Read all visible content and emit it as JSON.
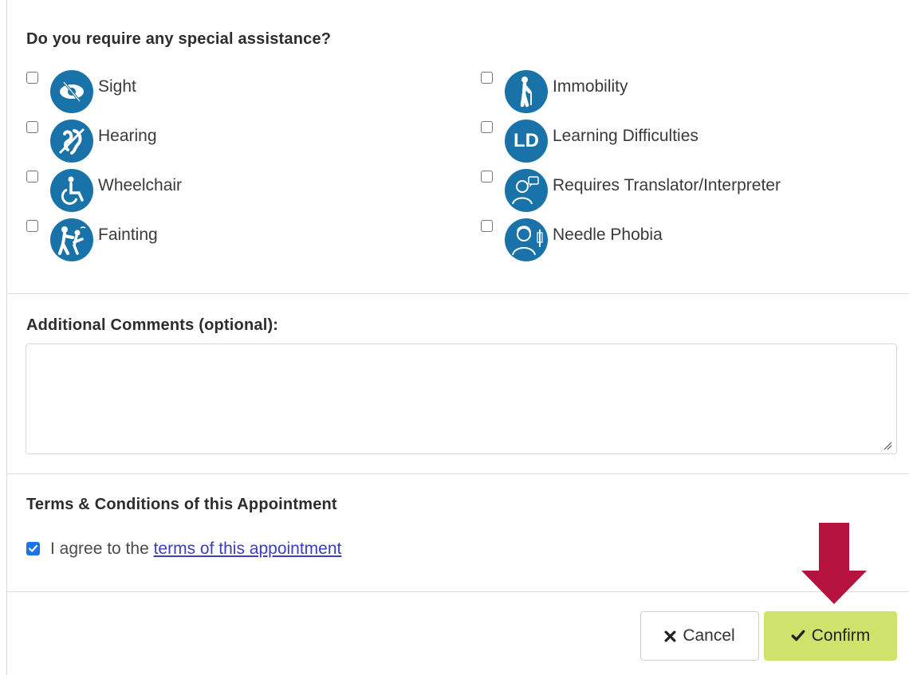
{
  "assistance": {
    "title": "Do you require any special assistance?",
    "options_left": [
      {
        "label": "Sight",
        "icon": "eye-slash-icon",
        "checked": false
      },
      {
        "label": "Hearing",
        "icon": "hearing-impaired-icon",
        "checked": false
      },
      {
        "label": "Wheelchair",
        "icon": "wheelchair-icon",
        "checked": false
      },
      {
        "label": "Fainting",
        "icon": "fainting-icon",
        "checked": false
      }
    ],
    "options_right": [
      {
        "label": "Immobility",
        "icon": "walking-cane-icon",
        "checked": false
      },
      {
        "label": "Learning Difficulties",
        "icon": "learning-difficulties-icon",
        "icon_text": "LD",
        "checked": false
      },
      {
        "label": "Requires Translator/Interpreter",
        "icon": "translator-icon",
        "checked": false
      },
      {
        "label": "Needle Phobia",
        "icon": "needle-phobia-icon",
        "checked": false
      }
    ],
    "icon_color": "#1a73a8"
  },
  "comments": {
    "title": "Additional Comments (optional):",
    "value": ""
  },
  "terms": {
    "title": "Terms & Conditions of this Appointment",
    "agree_prefix": "I agree to the ",
    "agree_link": "terms of this appointment",
    "checked": true
  },
  "actions": {
    "cancel_label": "Cancel",
    "cancel_icon": "x-icon",
    "confirm_label": "Confirm",
    "confirm_icon": "checkmark-icon",
    "confirm_color": "#cfe36c",
    "annotation_arrow_color": "#b5123f"
  }
}
